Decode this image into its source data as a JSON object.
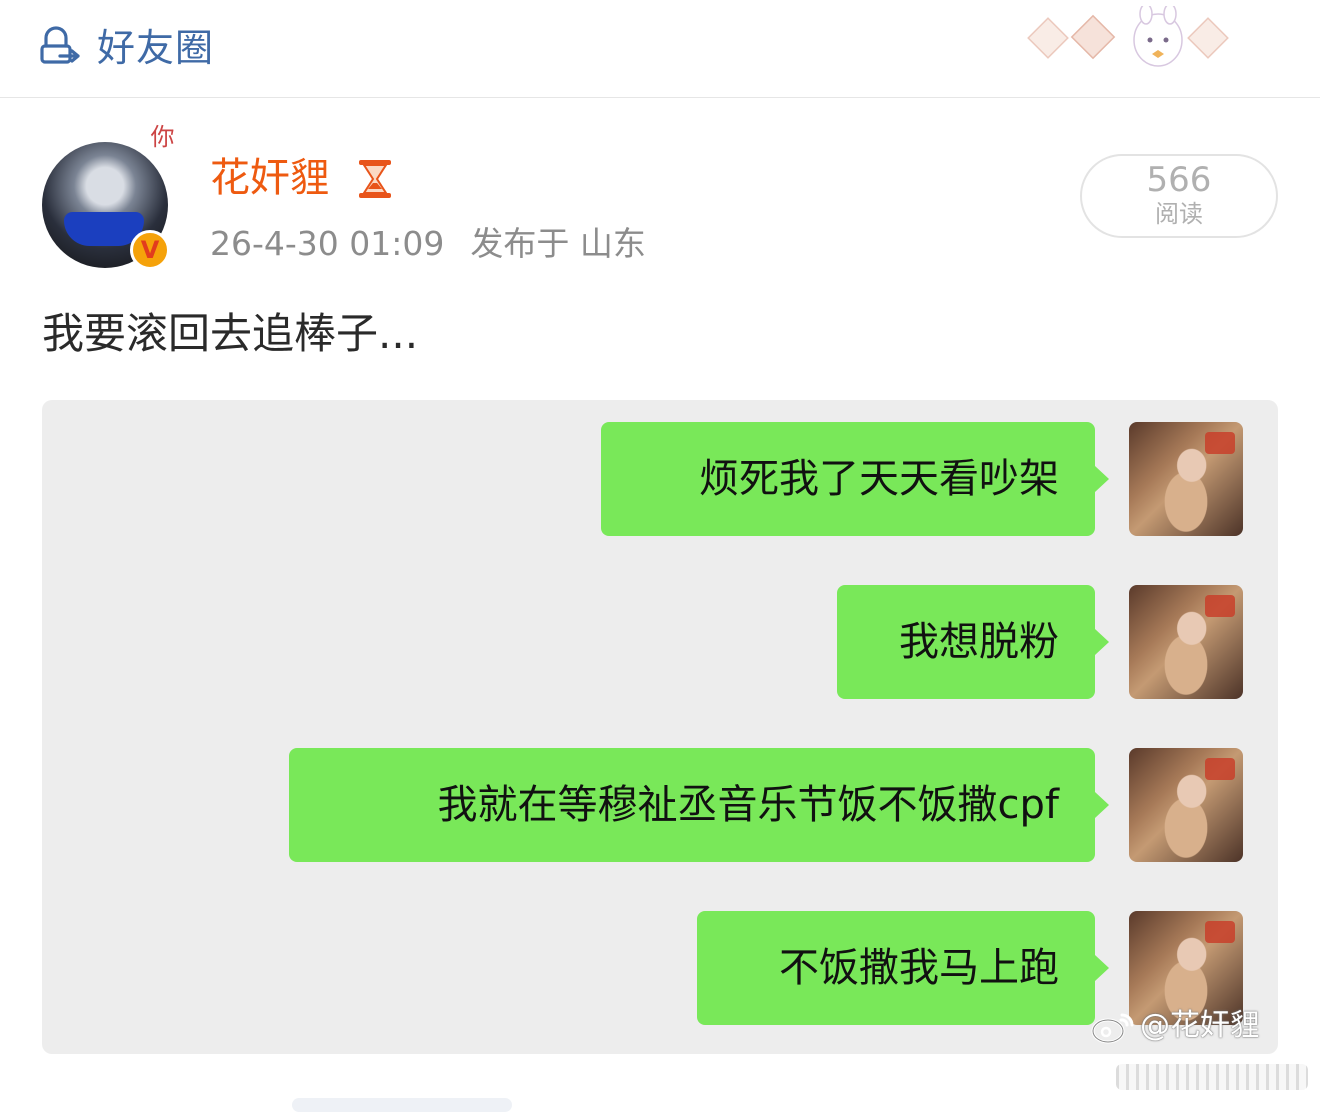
{
  "header": {
    "title": "好友圈",
    "icon": "friends-group-icon"
  },
  "post": {
    "author": "花奸貍",
    "avatar_overlay_text": "你",
    "verified_badge": "V",
    "timestamp": "26-4-30 01:09",
    "location": "发布于 山东",
    "reads_count": "566",
    "reads_label": "阅读",
    "text": "我要滚回去追棒子..."
  },
  "chat": {
    "messages": [
      {
        "text": "烦死我了天天看吵架"
      },
      {
        "text": "我想脱粉"
      },
      {
        "text": "我就在等穆祉丞音乐节饭不饭撒cpf"
      },
      {
        "text": "不饭撒我马上跑"
      }
    ]
  },
  "watermark": {
    "text": "@花奸貍"
  },
  "colors": {
    "accent_blue": "#3f6aa6",
    "username_orange": "#ee5a10",
    "bubble_green": "#79e859",
    "chat_background": "#ededed"
  }
}
